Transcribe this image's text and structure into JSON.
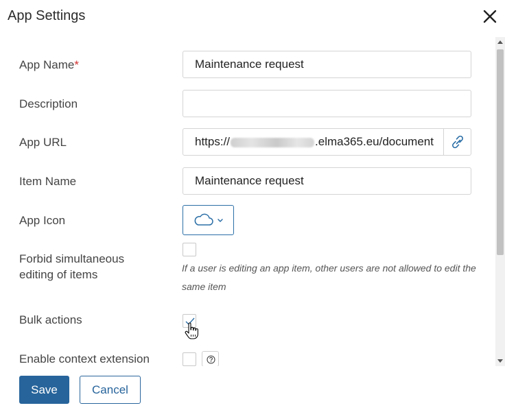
{
  "dialog": {
    "title": "App Settings",
    "close_icon": "close-icon"
  },
  "fields": {
    "app_name": {
      "label": "App Name",
      "required_mark": "*",
      "value": "Maintenance request"
    },
    "description": {
      "label": "Description",
      "value": ""
    },
    "app_url": {
      "label": "App URL",
      "value_prefix": "https://",
      "value_suffix": ".elma365.eu/document",
      "link_icon": "link-icon"
    },
    "item_name": {
      "label": "Item Name",
      "value": "Maintenance request"
    },
    "app_icon": {
      "label": "App Icon",
      "selected_icon": "cloud-icon",
      "dropdown_icon": "chevron-down-icon"
    },
    "forbid_editing": {
      "label": "Forbid simultaneous editing of items",
      "checked": false,
      "hint": "If a user is editing an app item, other users are not allowed to edit the same item"
    },
    "bulk_actions": {
      "label": "Bulk actions",
      "checked": true
    },
    "context_extension": {
      "label": "Enable context extension",
      "checked": false,
      "help_icon": "question-icon"
    }
  },
  "footer": {
    "save_label": "Save",
    "cancel_label": "Cancel"
  },
  "colors": {
    "accent": "#27649b",
    "required": "#d0302f",
    "border": "#d4d4d4"
  }
}
